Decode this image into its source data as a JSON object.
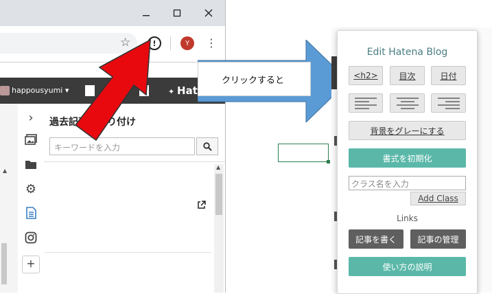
{
  "browser": {
    "avatar_letter": "Y",
    "hatena_user": "happousyumi",
    "hatena_logo": "Hat",
    "panel_title": "過去記事の貼り付け",
    "search_placeholder": "キーワードを入力"
  },
  "callout": {
    "text": "クリックすると"
  },
  "popup": {
    "title": "Edit Hatena Blog",
    "h2_label": "<h2>",
    "toc_label": "目次",
    "date_label": "日付",
    "gray_bg_label": "背景をグレーにする",
    "reset_format_label": "書式を初期化",
    "class_placeholder": "クラス名を入力",
    "add_class_label": "Add Class",
    "links_label": "Links",
    "write_article_label": "記事を書く",
    "manage_articles_label": "記事の管理",
    "howto_label": "使い方の説明"
  },
  "colors": {
    "teal": "#5bb8a9",
    "dark_button": "#5f5f5f",
    "arrow_red": "#e8090f",
    "arrow_blue": "#5b9bd5"
  }
}
